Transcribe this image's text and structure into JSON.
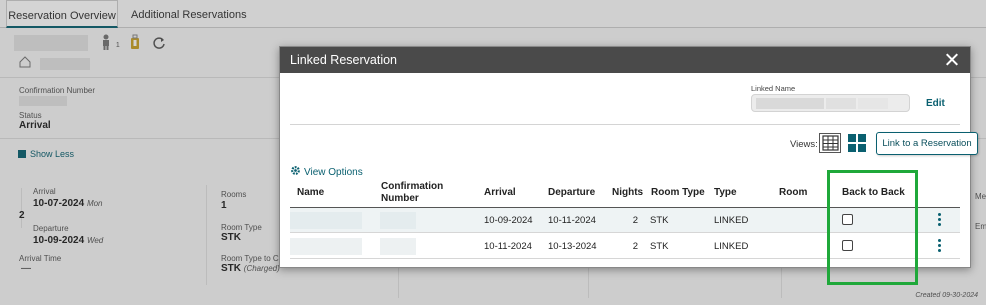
{
  "tabs": [
    "Reservation Overview",
    "Additional Reservations"
  ],
  "background": {
    "adults_count": "1",
    "confirmation_number_label": "Confirmation Number",
    "status_label": "Status",
    "status_value": "Arrival",
    "show_less": "Show Less",
    "arrival_label": "Arrival",
    "arrival_date": "10-07-2024",
    "arrival_day": "Mon",
    "nights": "2",
    "departure_label": "Departure",
    "departure_date": "10-09-2024",
    "departure_day": "Wed",
    "arrival_time_label": "Arrival Time",
    "arrival_time_value": "—",
    "rooms_label": "Rooms",
    "rooms_value": "1",
    "room_type_label": "Room Type",
    "room_type_value": "STK",
    "room_type_charged_label": "Room Type to Ch",
    "room_type_charged_value": "STK",
    "charged_note": "(Charged)",
    "right_label_1": "Me",
    "right_label_2": "Em",
    "created_text": "Created  09-30-2024"
  },
  "modal": {
    "title": "Linked Reservation",
    "linked_name_label": "Linked Name",
    "edit_label": "Edit",
    "views_label": "Views:",
    "link_button": "Link to a Reservation",
    "view_options": "View Options",
    "columns": {
      "name": "Name",
      "confirmation_1": "Confirmation",
      "confirmation_2": "Number",
      "arrival": "Arrival",
      "departure": "Departure",
      "nights": "Nights",
      "room_type": "Room Type",
      "type": "Type",
      "room": "Room",
      "back_to_back": "Back to Back"
    },
    "rows": [
      {
        "arrival": "10-09-2024",
        "departure": "10-11-2024",
        "nights": "2",
        "room_type": "STK",
        "type": "LINKED",
        "room": "",
        "back_to_back": false
      },
      {
        "arrival": "10-11-2024",
        "departure": "10-13-2024",
        "nights": "2",
        "room_type": "STK",
        "type": "LINKED",
        "room": "",
        "back_to_back": false
      }
    ]
  },
  "colors": {
    "accent": "#0a6070",
    "highlight": "#1fa83a",
    "modal_header": "#4a4a4a"
  },
  "icons": [
    "person-icon",
    "luggage-icon",
    "refresh-icon",
    "home-icon",
    "close-icon",
    "grid-view-icon",
    "tile-view-icon",
    "gear-icon",
    "kebab-icon"
  ]
}
